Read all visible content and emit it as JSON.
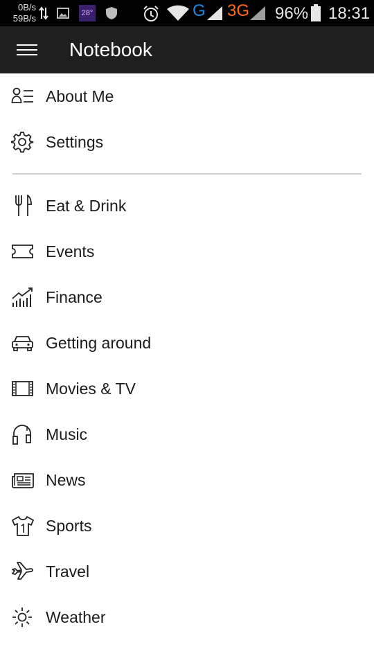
{
  "status_bar": {
    "speed_up": "0B/s",
    "speed_down": "59B/s",
    "temperature": "28°",
    "network_g": "G",
    "network_3g": "3G",
    "battery_percent": "96%",
    "time": "18:31",
    "icons": [
      "data-transfer-icon",
      "image-icon",
      "shield-icon",
      "alarm-icon",
      "wifi-icon",
      "signal-icon",
      "battery-icon"
    ]
  },
  "app_bar": {
    "title": "Notebook",
    "menu_icon": "hamburger-menu-icon"
  },
  "menu": {
    "top_items": [
      {
        "label": "About Me",
        "icon": "person-list-icon"
      },
      {
        "label": "Settings",
        "icon": "gear-icon"
      }
    ],
    "category_items": [
      {
        "label": "Eat & Drink",
        "icon": "fork-knife-icon"
      },
      {
        "label": "Events",
        "icon": "ticket-icon"
      },
      {
        "label": "Finance",
        "icon": "chart-icon"
      },
      {
        "label": "Getting around",
        "icon": "car-icon"
      },
      {
        "label": "Movies & TV",
        "icon": "film-icon"
      },
      {
        "label": "Music",
        "icon": "headphones-icon"
      },
      {
        "label": "News",
        "icon": "newspaper-icon"
      },
      {
        "label": "Sports",
        "icon": "jersey-icon"
      },
      {
        "label": "Travel",
        "icon": "airplane-icon"
      },
      {
        "label": "Weather",
        "icon": "sun-icon"
      }
    ]
  },
  "colors": {
    "status_bar_bg": "#000000",
    "app_bar_bg": "#1f1f1f",
    "page_bg": "#ffffff",
    "text": "#1b1b1b",
    "divider": "#cfcfcf",
    "network_g": "#1e88e5",
    "network_3g": "#ff6a1a"
  }
}
